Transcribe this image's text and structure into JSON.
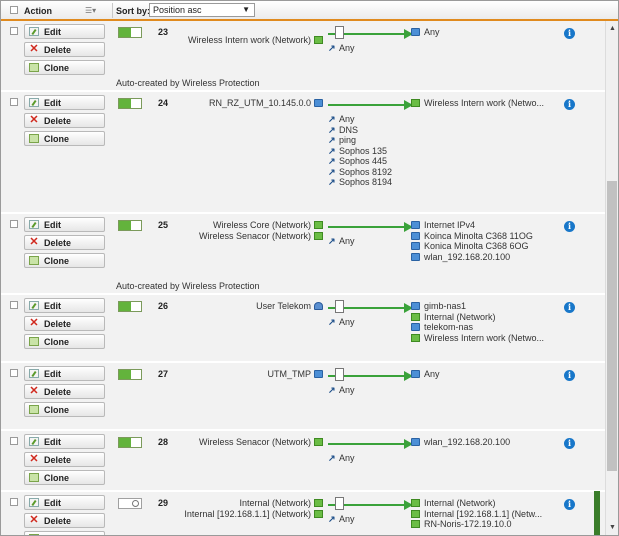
{
  "header": {
    "action_label": "Action",
    "sort_label": "Sort by:",
    "sort_value": "Position asc"
  },
  "button_labels": {
    "edit": "Edit",
    "delete": "Delete",
    "clone": "Clone"
  },
  "rows": [
    {
      "number": "23",
      "enabled": true,
      "sources": [
        {
          "name": "Wireless Intern work (Network)",
          "icon": "network-green-icon"
        }
      ],
      "services": [
        "Any"
      ],
      "destinations": [
        {
          "name": "Any",
          "icon": "any-blue-icon"
        }
      ],
      "note": "Auto-created by Wireless Protection"
    },
    {
      "number": "24",
      "enabled": true,
      "sources": [
        {
          "name": "RN_RZ_UTM_10.145.0.0",
          "icon": "network-blue-icon"
        }
      ],
      "services": [
        "Any",
        "DNS",
        "ping",
        "Sophos 135",
        "Sophos 445",
        "Sophos 8192",
        "Sophos 8194"
      ],
      "destinations": [
        {
          "name": "Wireless Intern work (Netwo...",
          "icon": "network-green-icon"
        }
      ],
      "note": ""
    },
    {
      "number": "25",
      "enabled": true,
      "sources": [
        {
          "name": "Wireless Core (Network)",
          "icon": "network-green-icon"
        },
        {
          "name": "Wireless Senacor (Network)",
          "icon": "network-green-icon"
        }
      ],
      "services": [
        "Any"
      ],
      "destinations": [
        {
          "name": "Internet IPv4",
          "icon": "network-blue-icon"
        },
        {
          "name": "Koinca Minolta C368 11OG",
          "icon": "host-blue-icon"
        },
        {
          "name": "Konica Minolta C368 6OG",
          "icon": "host-blue-icon"
        },
        {
          "name": "wlan_192.168.20.100",
          "icon": "host-blue-icon"
        }
      ],
      "note": "Auto-created by Wireless Protection"
    },
    {
      "number": "26",
      "enabled": true,
      "sources": [
        {
          "name": "User Telekom",
          "icon": "user-icon"
        }
      ],
      "services": [
        "Any"
      ],
      "destinations": [
        {
          "name": "gimb-nas1",
          "icon": "host-blue-icon"
        },
        {
          "name": "Internal (Network)",
          "icon": "network-green-icon"
        },
        {
          "name": "telekom-nas",
          "icon": "host-blue-icon"
        },
        {
          "name": "Wireless Intern work (Netwo...",
          "icon": "network-green-icon"
        }
      ],
      "note": ""
    },
    {
      "number": "27",
      "enabled": true,
      "sources": [
        {
          "name": "UTM_TMP",
          "icon": "host-blue-icon"
        }
      ],
      "services": [
        "Any"
      ],
      "destinations": [
        {
          "name": "Any",
          "icon": "any-blue-icon"
        }
      ],
      "note": ""
    },
    {
      "number": "28",
      "enabled": true,
      "sources": [
        {
          "name": "Wireless Senacor (Network)",
          "icon": "network-green-icon"
        }
      ],
      "services": [
        "Any"
      ],
      "destinations": [
        {
          "name": "wlan_192.168.20.100",
          "icon": "host-blue-icon"
        }
      ],
      "note": ""
    },
    {
      "number": "29",
      "enabled": false,
      "sources": [
        {
          "name": "Internal (Network)",
          "icon": "network-green-icon"
        },
        {
          "name": "Internal [192.168.1.1] (Network)",
          "icon": "network-green-icon"
        }
      ],
      "services": [
        "Any"
      ],
      "destinations": [
        {
          "name": "Internal (Network)",
          "icon": "network-green-icon"
        },
        {
          "name": "Internal [192.168.1.1] (Netw...",
          "icon": "network-green-icon"
        },
        {
          "name": "RN-Noris-172.19.10.0",
          "icon": "network-green-icon"
        }
      ],
      "note": ""
    }
  ],
  "colors": {
    "accent": "#e08a1e",
    "enabled_green": "#63b33c",
    "arrow_green": "#3aa23a",
    "info_blue": "#1877c9"
  }
}
